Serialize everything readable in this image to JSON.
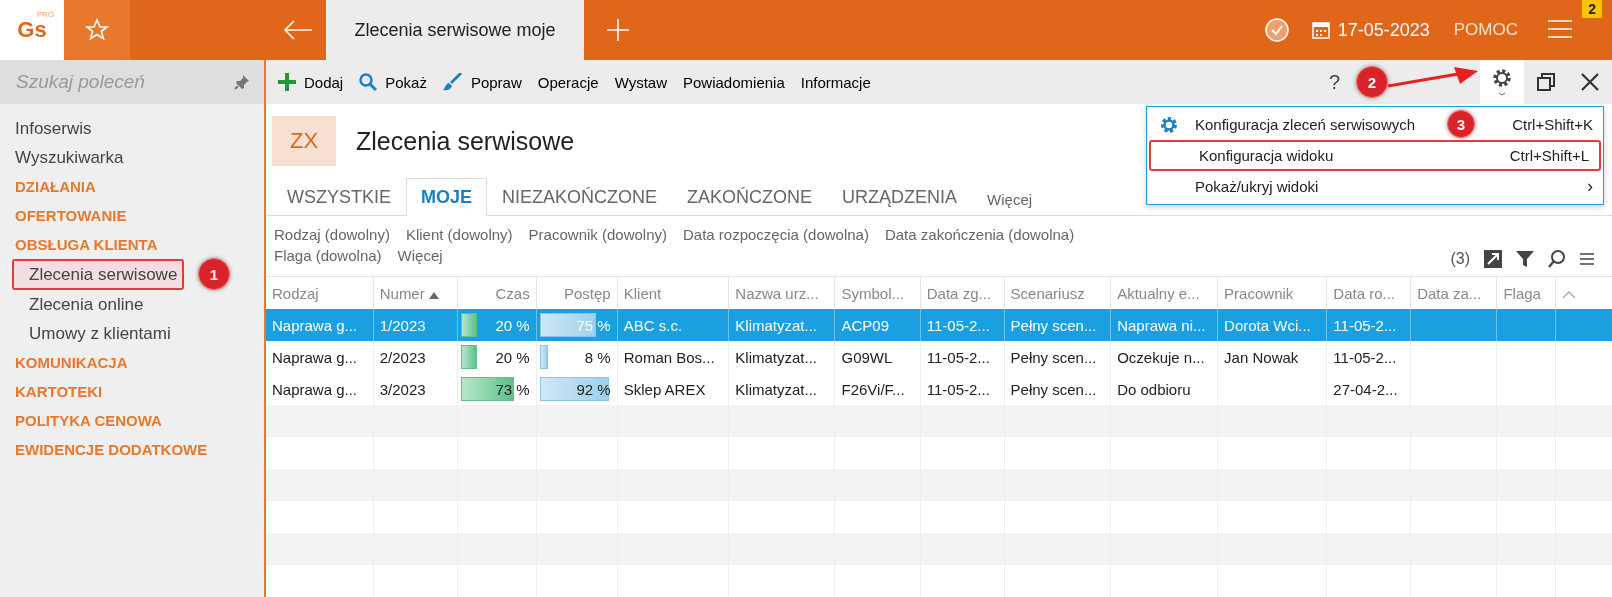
{
  "app": {
    "logo": "Gs",
    "logo_sup": "PRO"
  },
  "top_tab": {
    "title": "Zlecenia serwisowe moje"
  },
  "date": "17-05-2023",
  "help": "POMOC",
  "notification_count": "2",
  "sidebar": {
    "search_placeholder": "Szukaj poleceń",
    "items": [
      {
        "label": "Infoserwis",
        "kind": "link",
        "selected": false
      },
      {
        "label": "Wyszukiwarka",
        "kind": "link",
        "selected": false
      },
      {
        "label": "DZIAŁANIA",
        "kind": "section",
        "selected": false
      },
      {
        "label": "OFERTOWANIE",
        "kind": "section",
        "selected": false
      },
      {
        "label": "OBSŁUGA KLIENTA",
        "kind": "section",
        "selected": false
      },
      {
        "label": "Zlecenia serwisowe",
        "kind": "subitem",
        "selected": true,
        "callout": "1"
      },
      {
        "label": "Zlecenia online",
        "kind": "subitem",
        "selected": false
      },
      {
        "label": "Umowy z klientami",
        "kind": "subitem",
        "selected": false
      },
      {
        "label": "KOMUNIKACJA",
        "kind": "section",
        "selected": false
      },
      {
        "label": "KARTOTEKI",
        "kind": "section",
        "selected": false
      },
      {
        "label": "POLITYKA CENOWA",
        "kind": "section",
        "selected": false
      },
      {
        "label": "EWIDENCJE DODATKOWE",
        "kind": "section",
        "selected": false
      }
    ]
  },
  "toolbar": {
    "items": [
      {
        "label": "Dodaj",
        "kind": "add"
      },
      {
        "label": "Pokaż",
        "kind": "show"
      },
      {
        "label": "Popraw",
        "kind": "edit"
      },
      {
        "label": "Operacje"
      },
      {
        "label": "Wystaw"
      },
      {
        "label": "Powiadomienia"
      },
      {
        "label": "Informacje"
      }
    ],
    "help_button": "?",
    "settings_callout": "2"
  },
  "menu": {
    "items": [
      {
        "label": "Konfiguracja zleceń serwisowych",
        "shortcut": "Ctrl+Shift+K",
        "kind": "settings",
        "highlighted": false,
        "callout": "3"
      },
      {
        "label": "Konfiguracja widoku",
        "shortcut": "Ctrl+Shift+L",
        "highlighted": true
      },
      {
        "label": "Pokaż/ukryj widoki",
        "submenu": "›",
        "highlighted": false
      }
    ]
  },
  "module": {
    "badge": "ZX",
    "title": "Zlecenia serwisowe"
  },
  "tabs": [
    {
      "label": "WSZYSTKIE",
      "selected": false
    },
    {
      "label": "MOJE",
      "selected": true
    },
    {
      "label": "NIEZAKOŃCZONE",
      "selected": false
    },
    {
      "label": "ZAKOŃCZONE",
      "selected": false
    },
    {
      "label": "URZĄDZENIA",
      "selected": false
    },
    {
      "label": "Więcej",
      "selected": false,
      "kind": "more"
    }
  ],
  "filters": [
    "Rodzaj (dowolny)",
    "Klient (dowolny)",
    "Pracownik (dowolny)",
    "Data rozpoczęcia (dowolna)",
    "Data zakończenia (dowolna)",
    "Flaga (dowolna)",
    "Więcej"
  ],
  "record_count": "(3)",
  "table": {
    "columns": [
      {
        "label": "Rodzaj",
        "sorted": false
      },
      {
        "label": "Numer",
        "sorted": true
      },
      {
        "label": "Czas",
        "kind": "time-bar",
        "sorted": false
      },
      {
        "label": "Postęp",
        "kind": "progress-bar",
        "sorted": false
      },
      {
        "label": "Klient",
        "sorted": false
      },
      {
        "label": "Nazwa urz...",
        "sorted": false
      },
      {
        "label": "Symbol...",
        "sorted": false
      },
      {
        "label": "Data zg...",
        "sorted": false
      },
      {
        "label": "Scenariusz",
        "sorted": false
      },
      {
        "label": "Aktualny e...",
        "sorted": false
      },
      {
        "label": "Pracownik",
        "sorted": false
      },
      {
        "label": "Data ro...",
        "sorted": false
      },
      {
        "label": "Data za...",
        "sorted": false
      },
      {
        "label": "Flaga",
        "sorted": false
      }
    ],
    "rows": [
      {
        "selected": true,
        "cells": [
          {
            "text": "Naprawa g..."
          },
          {
            "text": "1/2023"
          },
          {
            "text": "20 %",
            "level": 0.2
          },
          {
            "text": "75 %",
            "level": 0.75
          },
          {
            "text": "ABC s.c."
          },
          {
            "text": "Klimatyzat..."
          },
          {
            "text": "ACP09"
          },
          {
            "text": "11-05-2..."
          },
          {
            "text": "Pełny scen..."
          },
          {
            "text": "Naprawa ni..."
          },
          {
            "text": "Dorota Wci..."
          },
          {
            "text": "11-05-2..."
          }
        ]
      },
      {
        "selected": false,
        "cells": [
          {
            "text": "Naprawa g..."
          },
          {
            "text": "2/2023"
          },
          {
            "text": "20 %",
            "level": 0.2
          },
          {
            "text": "8 %",
            "level": 0.08
          },
          {
            "text": "Roman Bos..."
          },
          {
            "text": "Klimatyzat..."
          },
          {
            "text": "G09WL"
          },
          {
            "text": "11-05-2..."
          },
          {
            "text": "Pełny scen..."
          },
          {
            "text": "Oczekuje n..."
          },
          {
            "text": "Jan Nowak"
          },
          {
            "text": "11-05-2..."
          }
        ]
      },
      {
        "selected": false,
        "cells": [
          {
            "text": "Naprawa g..."
          },
          {
            "text": "3/2023"
          },
          {
            "text": "73 %",
            "level": 0.73
          },
          {
            "text": "92 %",
            "level": 0.92
          },
          {
            "text": "Sklep AREX"
          },
          {
            "text": "Klimatyzat..."
          },
          {
            "text": "F26Vi/F..."
          },
          {
            "text": "11-05-2..."
          },
          {
            "text": "Pełny scen..."
          },
          {
            "text": "Do odbioru"
          },
          {
            "text": ""
          },
          {
            "text": "27-04-2..."
          }
        ]
      }
    ]
  }
}
